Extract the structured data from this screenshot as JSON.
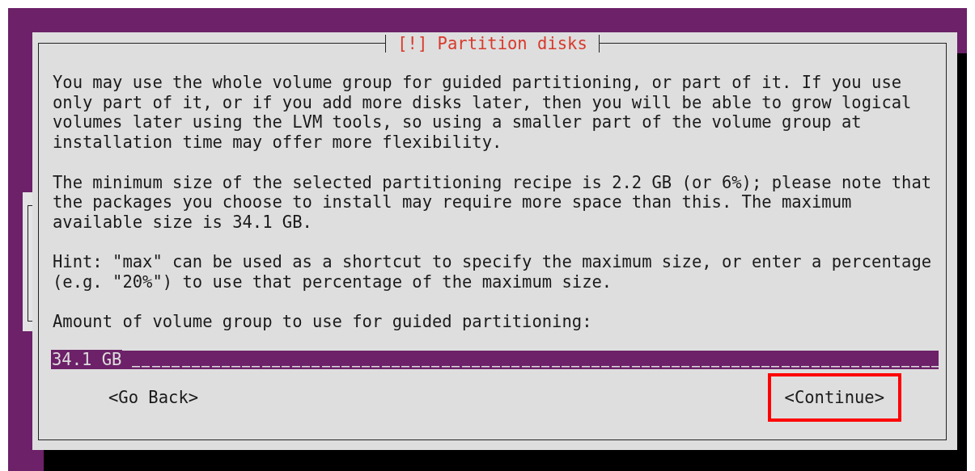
{
  "dialog": {
    "title": "[!] Partition disks",
    "paragraphs": [
      "You may use the whole volume group for guided partitioning, or part of it. If you use only part of it, or if you add more disks later, then you will be able to grow logical volumes later using the LVM tools, so using a smaller part of the volume group at installation time may offer more flexibility.",
      "The minimum size of the selected partitioning recipe is 2.2 GB (or 6%); please note that the packages you choose to install may require more space than this. The maximum available size is 34.1 GB.",
      "Hint: \"max\" can be used as a shortcut to specify the maximum size, or enter a percentage (e.g. \"20%\") to use that percentage of the maximum size."
    ],
    "prompt": "Amount of volume group to use for guided partitioning:",
    "field": {
      "value": "34.1 GB"
    },
    "buttons": [
      {
        "label": "<Go Back>",
        "highlighted": false
      },
      {
        "label": "<Continue>",
        "highlighted": true
      }
    ]
  }
}
